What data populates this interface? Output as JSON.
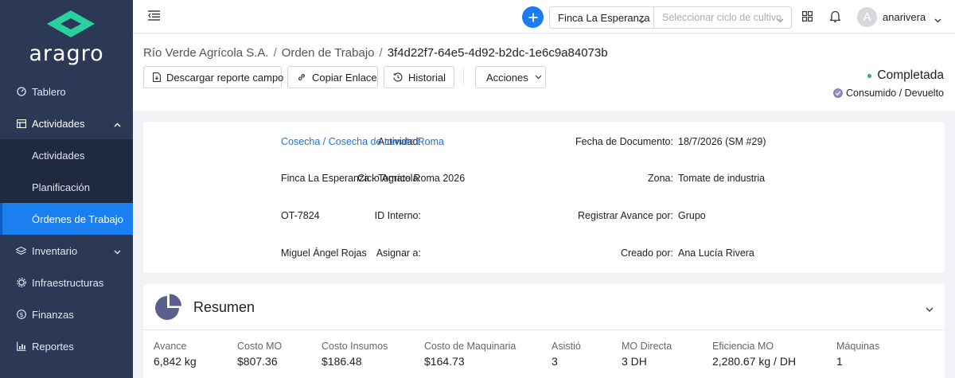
{
  "brand": {
    "name": "aragro",
    "logo_color": "#2ad0a0"
  },
  "sidebar": {
    "items": [
      {
        "label": "Tablero",
        "icon": "dashboard-icon"
      },
      {
        "label": "Actividades",
        "icon": "activities-icon",
        "expanded": true
      },
      {
        "label": "Actividades"
      },
      {
        "label": "Planificación"
      },
      {
        "label": "Órdenes de Trabajo",
        "active": true
      },
      {
        "label": "Inventario",
        "icon": "inventory-icon"
      },
      {
        "label": "Infraestructuras",
        "icon": "gear-icon"
      },
      {
        "label": "Finanzas",
        "icon": "dollar-icon"
      },
      {
        "label": "Reportes",
        "icon": "chart-icon"
      }
    ]
  },
  "topbar": {
    "farm": "Finca La Esperanza",
    "cycle_placeholder": "Seleccionar ciclo de cultivo",
    "avatar_initial": "A",
    "username": "anarivera"
  },
  "breadcrumb": {
    "company": "Río Verde Agrícola S.A.",
    "section": "Orden de Trabajo",
    "id": "3f4d22f7-64e5-4d92-b2dc-1e6c9a84073b"
  },
  "actions": {
    "download": "Descargar reporte campo",
    "copy_link": "Copiar Enlace",
    "history": "Historial",
    "actions": "Acciones"
  },
  "status": {
    "main": "Completada",
    "sub": "Consumido / Devuelto",
    "color": "#2fb344"
  },
  "details": {
    "activity_label": "Actividad",
    "activity_value": "Cosecha / Cosecha de tomate Roma",
    "cycle_label": "Ciclo Agrícola",
    "cycle_value": "Finca La Esperanza - Tomate Roma 2026",
    "internal_id_label": "ID Interno",
    "internal_id_value": "OT-7824",
    "assign_label": "Asignar a",
    "assign_value": "Miguel Ángel Rojas",
    "date_label": "Fecha de Documento",
    "date_value": "18/7/2026  (SM #29)",
    "zone_label": "Zona",
    "zone_value": "Tomate de industria",
    "progress_label": "Registrar Avance por",
    "progress_value": "Grupo",
    "created_label": "Creado por",
    "created_value": "Ana Lucía Rivera"
  },
  "summary": {
    "title": "Resumen",
    "metrics": [
      {
        "label": "Avance",
        "value": "6,842 kg"
      },
      {
        "label": "Costo MO",
        "value": "$807.36"
      },
      {
        "label": "Costo Insumos",
        "value": "$186.48"
      },
      {
        "label": "Costo de Maquinaria",
        "value": "$164.73"
      },
      {
        "label": "Asistió",
        "value": "3"
      },
      {
        "label": "MO Directa",
        "value": "3 DH"
      },
      {
        "label": "Eficiencia MO",
        "value": "2,280.67 kg / DH"
      },
      {
        "label": "Máquinas",
        "value": "1"
      }
    ]
  }
}
